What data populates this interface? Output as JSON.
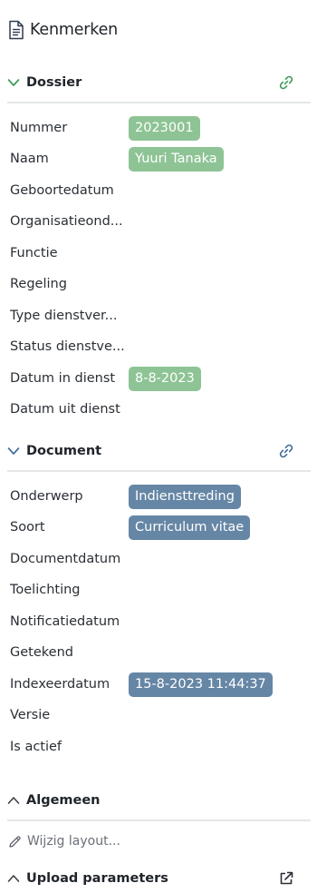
{
  "panel": {
    "title": "Kenmerken",
    "icon": "document-icon"
  },
  "sections": {
    "dossier": {
      "title": "Dossier",
      "link_icon": "link-icon",
      "rows": [
        {
          "label": "Nummer",
          "value": "2023001"
        },
        {
          "label": "Naam",
          "value": "Yuuri Tanaka"
        },
        {
          "label": "Geboortedatum",
          "value": ""
        },
        {
          "label": "Organisatieond...",
          "value": ""
        },
        {
          "label": "Functie",
          "value": ""
        },
        {
          "label": "Regeling",
          "value": ""
        },
        {
          "label": "Type dienstver...",
          "value": ""
        },
        {
          "label": "Status dienstve...",
          "value": ""
        },
        {
          "label": "Datum in dienst",
          "value": "8-8-2023"
        },
        {
          "label": "Datum uit dienst",
          "value": ""
        }
      ]
    },
    "document": {
      "title": "Document",
      "link_icon": "link-icon",
      "rows": [
        {
          "label": "Onderwerp",
          "value": "Indiensttreding"
        },
        {
          "label": "Soort",
          "value": "Curriculum vitae"
        },
        {
          "label": "Documentdatum",
          "value": ""
        },
        {
          "label": "Toelichting",
          "value": ""
        },
        {
          "label": "Notificatiedatum",
          "value": ""
        },
        {
          "label": "Getekend",
          "value": ""
        },
        {
          "label": "Indexeerdatum",
          "value": "15-8-2023 11:44:37"
        },
        {
          "label": "Versie",
          "value": ""
        },
        {
          "label": "Is actief",
          "value": ""
        }
      ]
    },
    "algemeen": {
      "title": "Algemeen"
    },
    "edit_layout": {
      "label": "Wijzig layout...",
      "icon": "pencil-icon"
    },
    "upload": {
      "title": "Upload parameters",
      "icon": "external-link-icon"
    }
  },
  "colors": {
    "green_badge": "#8ec495",
    "blue_badge": "#6686a5",
    "accent_green": "#3f9a5a",
    "accent_blue": "#3f6d99"
  }
}
